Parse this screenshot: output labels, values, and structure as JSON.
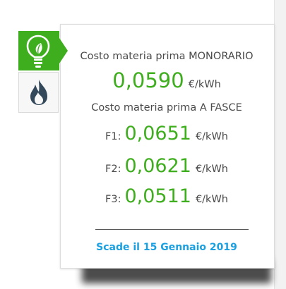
{
  "tabs": [
    {
      "name": "electricity",
      "icon": "lightbulb-leaf-icon",
      "active": true,
      "color": "#3fae1e"
    },
    {
      "name": "gas",
      "icon": "flame-icon",
      "active": false,
      "color": "#33485a"
    }
  ],
  "card": {
    "monorario_label": "Costo materia prima MONORARIO",
    "monorario_price": "0,0590",
    "monorario_unit": "€/kWh",
    "fasce_label": "Costo materia prima A FASCE",
    "bands": [
      {
        "label": "F1:",
        "price": "0,0651",
        "unit": "€/kWh"
      },
      {
        "label": "F2:",
        "price": "0,0621",
        "unit": "€/kWh"
      },
      {
        "label": "F3:",
        "price": "0,0511",
        "unit": "€/kWh"
      }
    ],
    "expiry": "Scade il 15 Gennaio 2019"
  },
  "colors": {
    "accent_green": "#3fae1e",
    "link_blue": "#1a9fe0",
    "text_gray": "#4a4a4a"
  }
}
